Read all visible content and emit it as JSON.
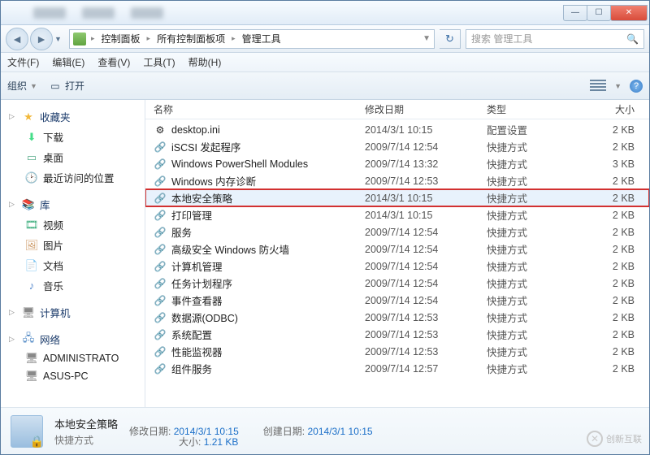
{
  "breadcrumb": [
    "控制面板",
    "所有控制面板项",
    "管理工具"
  ],
  "search_placeholder": "搜索 管理工具",
  "menu": {
    "file": "文件(F)",
    "edit": "编辑(E)",
    "view": "查看(V)",
    "tools": "工具(T)",
    "help": "帮助(H)"
  },
  "toolbar": {
    "organize": "组织",
    "open": "打开"
  },
  "columns": {
    "name": "名称",
    "date": "修改日期",
    "type": "类型",
    "size": "大小"
  },
  "sidebar": {
    "favorites": {
      "label": "收藏夹",
      "items": [
        {
          "icon": "download-icon",
          "label": "下载"
        },
        {
          "icon": "desktop-icon",
          "label": "桌面"
        },
        {
          "icon": "recent-icon",
          "label": "最近访问的位置"
        }
      ]
    },
    "libraries": {
      "label": "库",
      "items": [
        {
          "icon": "video-icon",
          "label": "视频"
        },
        {
          "icon": "picture-icon",
          "label": "图片"
        },
        {
          "icon": "document-icon",
          "label": "文档"
        },
        {
          "icon": "music-icon",
          "label": "音乐"
        }
      ]
    },
    "computer": {
      "label": "计算机"
    },
    "network": {
      "label": "网络",
      "items": [
        {
          "icon": "pc-icon",
          "label": "ADMINISTRATO"
        },
        {
          "icon": "pc-icon",
          "label": "ASUS-PC"
        }
      ]
    }
  },
  "files": [
    {
      "icon": "⚙",
      "name": "desktop.ini",
      "date": "2014/3/1 10:15",
      "type": "配置设置",
      "size": "2 KB"
    },
    {
      "icon": "🔗",
      "name": "iSCSI 发起程序",
      "date": "2009/7/14 12:54",
      "type": "快捷方式",
      "size": "2 KB"
    },
    {
      "icon": "🔗",
      "name": "Windows PowerShell Modules",
      "date": "2009/7/14 13:32",
      "type": "快捷方式",
      "size": "3 KB"
    },
    {
      "icon": "🔗",
      "name": "Windows 内存诊断",
      "date": "2009/7/14 12:53",
      "type": "快捷方式",
      "size": "2 KB"
    },
    {
      "icon": "🔗",
      "name": "本地安全策略",
      "date": "2014/3/1 10:15",
      "type": "快捷方式",
      "size": "2 KB",
      "selected": true,
      "highlight": true
    },
    {
      "icon": "🔗",
      "name": "打印管理",
      "date": "2014/3/1 10:15",
      "type": "快捷方式",
      "size": "2 KB"
    },
    {
      "icon": "🔗",
      "name": "服务",
      "date": "2009/7/14 12:54",
      "type": "快捷方式",
      "size": "2 KB"
    },
    {
      "icon": "🔗",
      "name": "高级安全 Windows 防火墙",
      "date": "2009/7/14 12:54",
      "type": "快捷方式",
      "size": "2 KB"
    },
    {
      "icon": "🔗",
      "name": "计算机管理",
      "date": "2009/7/14 12:54",
      "type": "快捷方式",
      "size": "2 KB"
    },
    {
      "icon": "🔗",
      "name": "任务计划程序",
      "date": "2009/7/14 12:54",
      "type": "快捷方式",
      "size": "2 KB"
    },
    {
      "icon": "🔗",
      "name": "事件查看器",
      "date": "2009/7/14 12:54",
      "type": "快捷方式",
      "size": "2 KB"
    },
    {
      "icon": "🔗",
      "name": "数据源(ODBC)",
      "date": "2009/7/14 12:53",
      "type": "快捷方式",
      "size": "2 KB"
    },
    {
      "icon": "🔗",
      "name": "系统配置",
      "date": "2009/7/14 12:53",
      "type": "快捷方式",
      "size": "2 KB"
    },
    {
      "icon": "🔗",
      "name": "性能监视器",
      "date": "2009/7/14 12:53",
      "type": "快捷方式",
      "size": "2 KB"
    },
    {
      "icon": "🔗",
      "name": "组件服务",
      "date": "2009/7/14 12:57",
      "type": "快捷方式",
      "size": "2 KB"
    }
  ],
  "details": {
    "title": "本地安全策略",
    "subtitle": "快捷方式",
    "modified_label": "修改日期:",
    "modified_value": "2014/3/1 10:15",
    "created_label": "创建日期:",
    "created_value": "2014/3/1 10:15",
    "size_label": "大小:",
    "size_value": "1.21 KB"
  },
  "watermark": "创新互联"
}
